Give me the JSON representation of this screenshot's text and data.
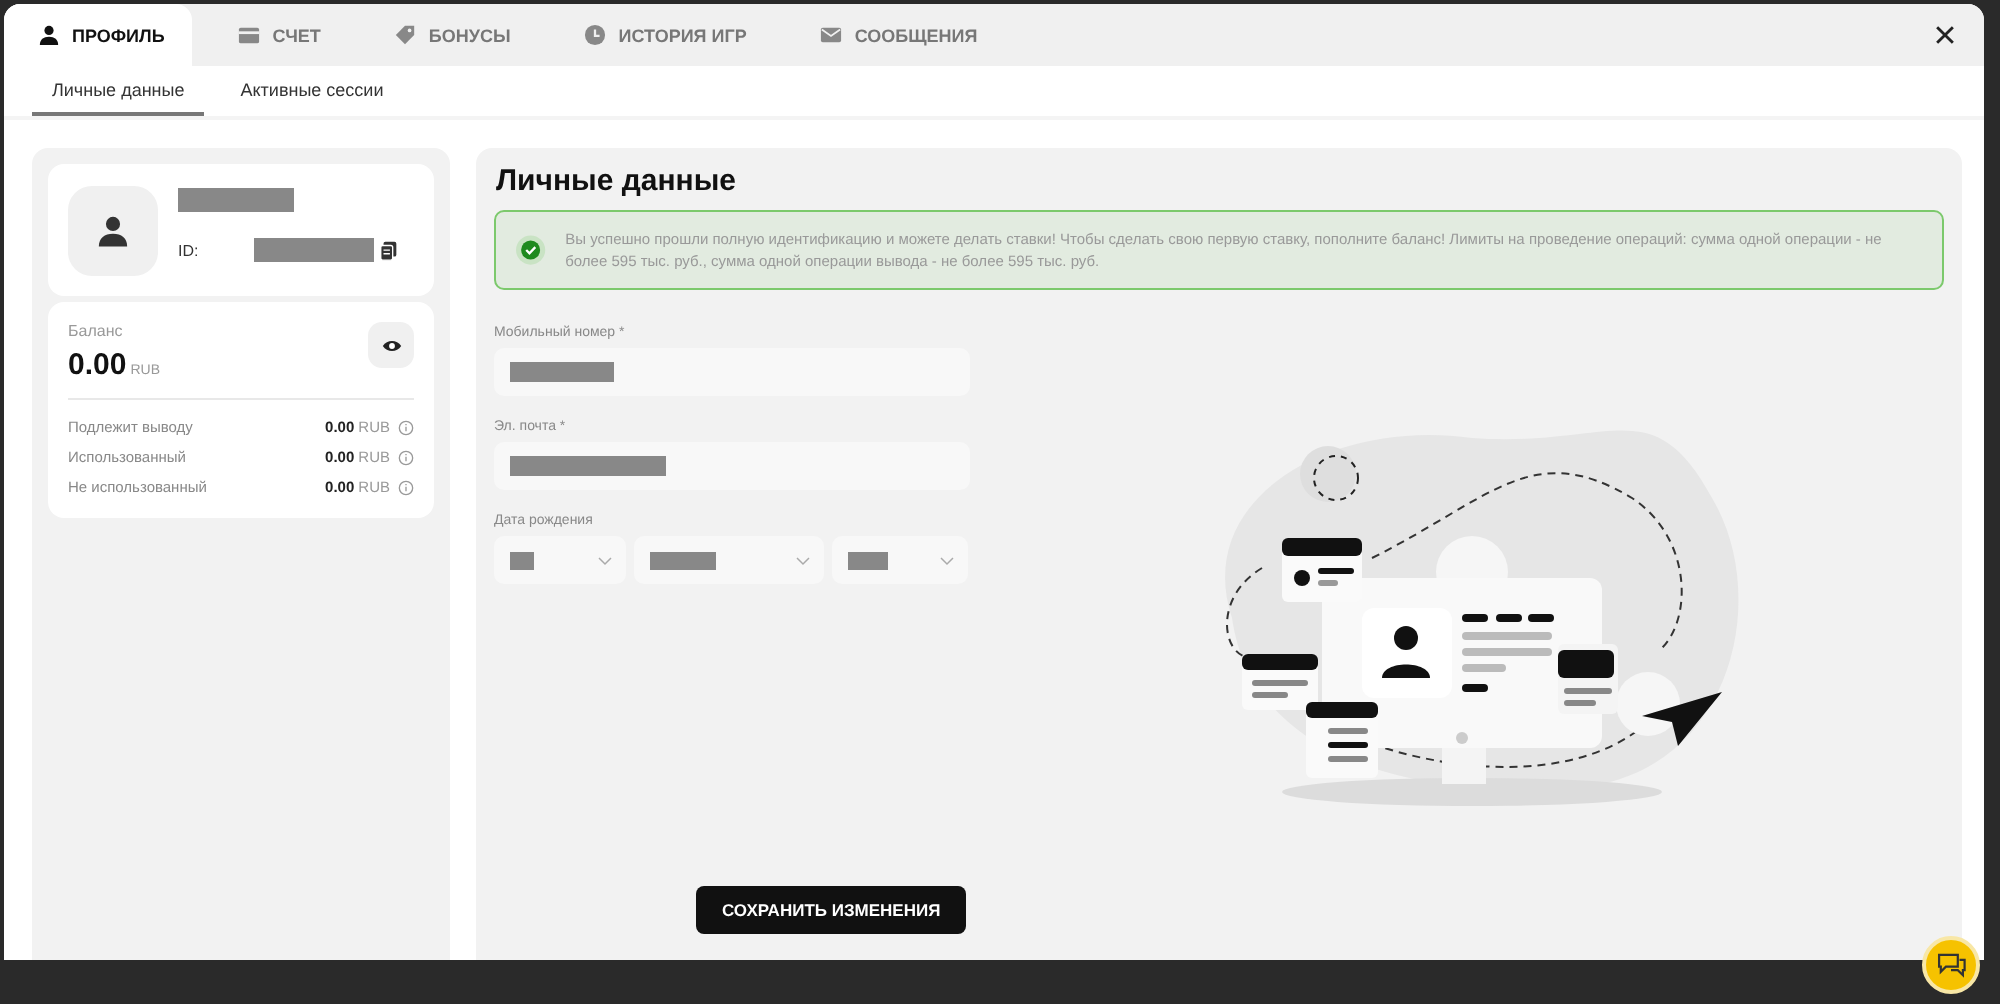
{
  "tabs": [
    {
      "label": "ПРОФИЛЬ",
      "selected": true
    },
    {
      "label": "СЧЕТ",
      "selected": false
    },
    {
      "label": "БОНУСЫ",
      "selected": false
    },
    {
      "label": "ИСТОРИЯ ИГР",
      "selected": false
    },
    {
      "label": "СООБЩЕНИЯ",
      "selected": false
    }
  ],
  "subtabs": [
    {
      "label": "Личные данные",
      "selected": true
    },
    {
      "label": "Активные сессии",
      "selected": false
    }
  ],
  "account": {
    "id_label": "ID:",
    "balance_label": "Баланс",
    "balance": "0.00",
    "currency": "RUB",
    "rows": [
      {
        "label": "Подлежит выводу",
        "value": "0.00",
        "currency": "RUB"
      },
      {
        "label": "Использованный",
        "value": "0.00",
        "currency": "RUB"
      },
      {
        "label": "Не использованный",
        "value": "0.00",
        "currency": "RUB"
      }
    ]
  },
  "form": {
    "title": "Личные данные",
    "notice": "Вы успешно прошли полную идентификацию и можете делать ставки! Чтобы сделать свою первую ставку, пополните баланс! Лимиты на проведение операций: сумма одной операции - не более 595 тыс. руб., сумма одной операции вывода - не более 595 тыс. руб.",
    "phone_label": "Мобильный номер *",
    "email_label": "Эл. почта *",
    "birth_label": "Дата рождения",
    "save_button": "СОХРАНИТЬ ИЗМЕНЕНИЯ"
  }
}
